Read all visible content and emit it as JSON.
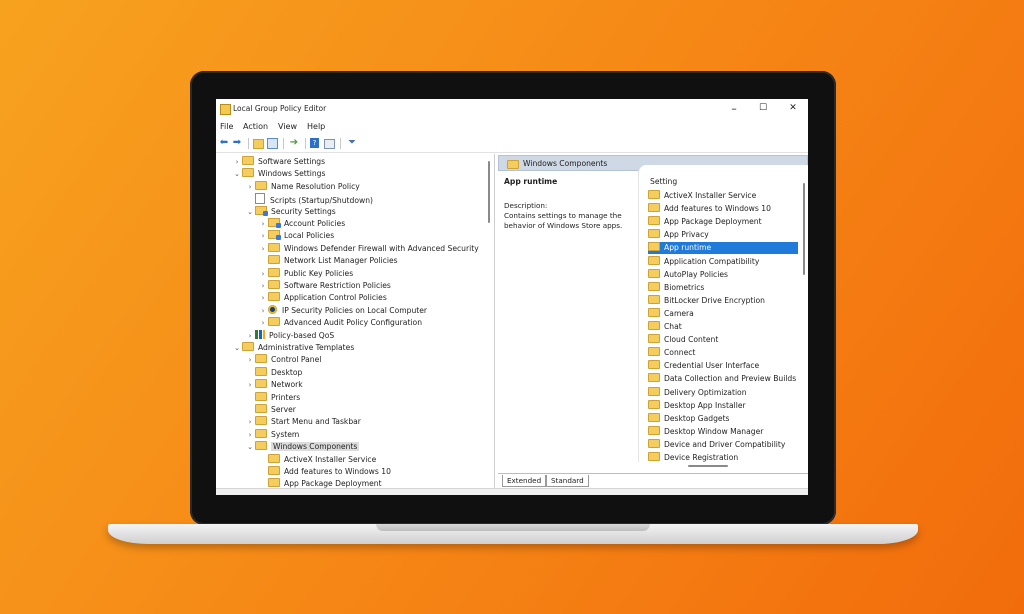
{
  "window": {
    "title": "Local Group Policy Editor",
    "minimize": "–",
    "maximize": "☐",
    "close": "✕"
  },
  "menu": [
    "File",
    "Action",
    "View",
    "Help"
  ],
  "toolbar_icons": [
    "back-arrow-icon",
    "forward-arrow-icon",
    "up-folder-icon",
    "show-hide-tree-icon",
    "export-list-icon",
    "help-icon",
    "properties-view-icon",
    "filter-icon"
  ],
  "tree": [
    {
      "label": "Software Settings",
      "depth": 1,
      "chev": ">",
      "icon": "folder"
    },
    {
      "label": "Windows Settings",
      "depth": 1,
      "chev": "v",
      "icon": "folder"
    },
    {
      "label": "Name Resolution Policy",
      "depth": 2,
      "chev": ">",
      "icon": "folder"
    },
    {
      "label": "Scripts (Startup/Shutdown)",
      "depth": 2,
      "chev": "",
      "icon": "doc"
    },
    {
      "label": "Security Settings",
      "depth": 2,
      "chev": "v",
      "icon": "shield"
    },
    {
      "label": "Account Policies",
      "depth": 3,
      "chev": ">",
      "icon": "shield"
    },
    {
      "label": "Local Policies",
      "depth": 3,
      "chev": ">",
      "icon": "shield"
    },
    {
      "label": "Windows Defender Firewall with Advanced Security",
      "depth": 3,
      "chev": ">",
      "icon": "folder"
    },
    {
      "label": "Network List Manager Policies",
      "depth": 3,
      "chev": "",
      "icon": "folder"
    },
    {
      "label": "Public Key Policies",
      "depth": 3,
      "chev": ">",
      "icon": "folder"
    },
    {
      "label": "Software Restriction Policies",
      "depth": 3,
      "chev": ">",
      "icon": "folder"
    },
    {
      "label": "Application Control Policies",
      "depth": 3,
      "chev": ">",
      "icon": "folder"
    },
    {
      "label": "IP Security Policies on Local Computer",
      "depth": 3,
      "chev": ">",
      "icon": "lock"
    },
    {
      "label": "Advanced Audit Policy Configuration",
      "depth": 3,
      "chev": ">",
      "icon": "folder"
    },
    {
      "label": "Policy-based QoS",
      "depth": 2,
      "chev": ">",
      "icon": "bar"
    },
    {
      "label": "Administrative Templates",
      "depth": 1,
      "chev": "v",
      "icon": "folder"
    },
    {
      "label": "Control Panel",
      "depth": 2,
      "chev": ">",
      "icon": "folder"
    },
    {
      "label": "Desktop",
      "depth": 2,
      "chev": "",
      "icon": "folder"
    },
    {
      "label": "Network",
      "depth": 2,
      "chev": ">",
      "icon": "folder"
    },
    {
      "label": "Printers",
      "depth": 2,
      "chev": "",
      "icon": "folder"
    },
    {
      "label": "Server",
      "depth": 2,
      "chev": "",
      "icon": "folder"
    },
    {
      "label": "Start Menu and Taskbar",
      "depth": 2,
      "chev": ">",
      "icon": "folder"
    },
    {
      "label": "System",
      "depth": 2,
      "chev": ">",
      "icon": "folder"
    },
    {
      "label": "Windows Components",
      "depth": 2,
      "chev": "v",
      "icon": "folder",
      "selected": true
    },
    {
      "label": "ActiveX Installer Service",
      "depth": 3,
      "chev": "",
      "icon": "folder"
    },
    {
      "label": "Add features to Windows 10",
      "depth": 3,
      "chev": "",
      "icon": "folder"
    },
    {
      "label": "App Package Deployment",
      "depth": 3,
      "chev": "",
      "icon": "folder"
    }
  ],
  "detail": {
    "header": "Windows Components",
    "selected_title": "App runtime",
    "description_label": "Description:",
    "description_lines": [
      "Contains settings to manage the",
      "behavior of Windows Store apps."
    ],
    "column_header": "Setting",
    "items": [
      "ActiveX Installer Service",
      "Add features to Windows 10",
      "App Package Deployment",
      "App Privacy",
      "App runtime",
      "Application Compatibility",
      "AutoPlay Policies",
      "Biometrics",
      "BitLocker Drive Encryption",
      "Camera",
      "Chat",
      "Cloud Content",
      "Connect",
      "Credential User Interface",
      "Data Collection and Preview Builds",
      "Delivery Optimization",
      "Desktop App Installer",
      "Desktop Gadgets",
      "Desktop Window Manager",
      "Device and Driver Compatibility",
      "Device Registration"
    ],
    "selected_index": 4,
    "tabs": [
      "Extended",
      "Standard"
    ]
  }
}
